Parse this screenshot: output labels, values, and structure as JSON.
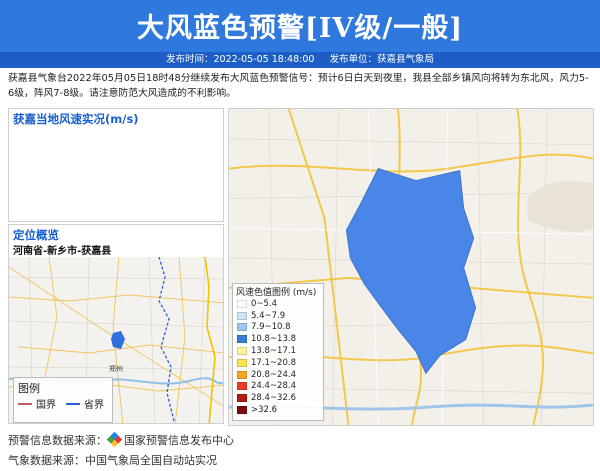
{
  "header": {
    "title": "大风蓝色预警[IV级/一般]",
    "publish_time": "发布时间：2022-05-05 18:48:00",
    "publish_unit": "发布单位：获嘉县气象局"
  },
  "description": "获嘉县气象台2022年05月05日18时48分继续发布大风蓝色预警信号：预计6日白天到夜里，我县全部乡镇风向将转为东北风，风力5-6级，阵风7-8级。请注意防范大风造成的不利影响。",
  "wind_panel": {
    "title": "获嘉当地风速实况(m/s)"
  },
  "location_panel": {
    "title": "定位概览",
    "path": "河南省-新乡市-获嘉县",
    "map_legend": {
      "title": "图例",
      "items": [
        {
          "label": "国界",
          "color": "#c2586a"
        },
        {
          "label": "省界",
          "color": "#2b5fd9"
        }
      ]
    },
    "city_label": "郑州"
  },
  "main_map": {
    "warning_area_color": "#4a86e8",
    "road_color": "#f3c74a"
  },
  "wind_scale": {
    "title": "风速色值图例 (m/s)",
    "items": [
      {
        "label": "0~5.4",
        "color": "#ffffff"
      },
      {
        "label": "5.4~7.9",
        "color": "#cfe3f7"
      },
      {
        "label": "7.9~10.8",
        "color": "#9cc8f0"
      },
      {
        "label": "10.8~13.8",
        "color": "#3a7bd5"
      },
      {
        "label": "13.8~17.1",
        "color": "#fff59d"
      },
      {
        "label": "17.1~20.8",
        "color": "#fbe34c"
      },
      {
        "label": "20.8~24.4",
        "color": "#f5a623"
      },
      {
        "label": "24.4~28.4",
        "color": "#ee3b24"
      },
      {
        "label": "28.4~32.6",
        "color": "#b31a12"
      },
      {
        "label": ">32.6",
        "color": "#7a0e0e"
      }
    ]
  },
  "footer": {
    "warning_source": "预警信息数据来源：",
    "warning_source_name": "国家预警信息发布中心",
    "weather_source": "气象数据来源：中国气象局全国自动站实况"
  }
}
